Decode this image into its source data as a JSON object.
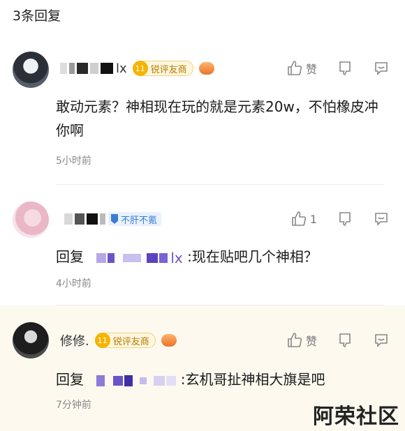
{
  "header": {
    "title": "3条回复"
  },
  "comments": [
    {
      "username_suffix": "lx",
      "badge_level": "11",
      "badge_text": "锐评友商",
      "text": "敢动元素？神相现在玩的就是元素20w，不怕橡皮冲你啊",
      "time": "5小时前",
      "like_label": "赞"
    },
    {
      "fan_badge": "不肝不氪",
      "reply_prefix": "回复",
      "reply_target_suffix": "lx",
      "text": ":现在贴吧几个神相？",
      "time": "4小时前",
      "like_count": "1"
    },
    {
      "username": "修修.",
      "badge_level": "11",
      "badge_text": "锐评友商",
      "reply_prefix": "回复",
      "text": ":玄机哥扯神相大旗是吧",
      "time": "7分钟前",
      "like_label": "赞"
    }
  ],
  "watermark": "阿荣社区"
}
